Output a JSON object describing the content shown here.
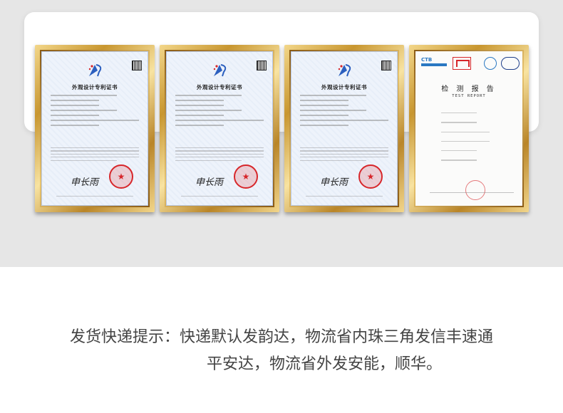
{
  "certificates": [
    {
      "kind": "patent",
      "title": "外观设计专利证书"
    },
    {
      "kind": "patent",
      "title": "外观设计专利证书"
    },
    {
      "kind": "patent",
      "title": "外观设计专利证书"
    },
    {
      "kind": "report",
      "title": "检 测 报 告",
      "subtitle": "TEST REPORT",
      "logo_text": "CTB"
    }
  ],
  "notice": {
    "line1": "发货快递提示：快递默认发韵达，物流省内珠三角发信丰速通",
    "line2": "平安达，物流省外发安能，顺华。"
  },
  "colors": {
    "band": "#e6e6e6",
    "frame_gold": "#c8962f",
    "seal_red": "#d7262a",
    "text": "#444444"
  }
}
